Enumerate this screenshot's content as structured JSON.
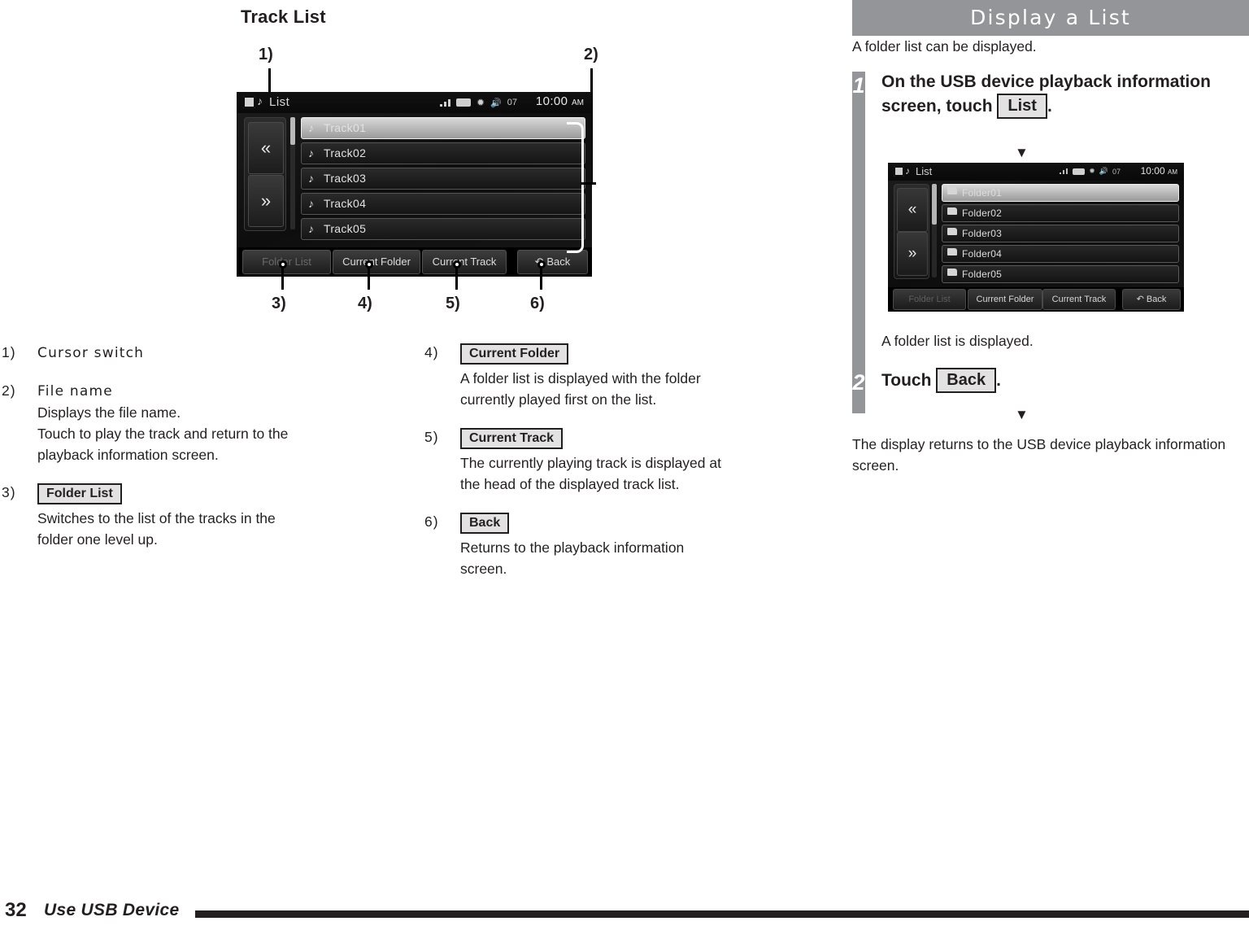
{
  "figure": {
    "title": "Track List",
    "callout_labels": [
      "1)",
      "2)",
      "3)",
      "4)",
      "5)",
      "6)"
    ],
    "device_screen": {
      "title": "List",
      "clock": "10:00",
      "clock_ampm": "AM",
      "volume": "07",
      "status_icons": [
        "signal-icon",
        "battery-icon",
        "bluetooth-icon",
        "volume-icon"
      ],
      "rows": [
        {
          "icon": "music-note-icon",
          "label": "Track01",
          "selected": true
        },
        {
          "icon": "music-note-icon",
          "label": "Track02",
          "selected": false
        },
        {
          "icon": "music-note-icon",
          "label": "Track03",
          "selected": false
        },
        {
          "icon": "music-note-icon",
          "label": "Track04",
          "selected": false
        },
        {
          "icon": "music-note-icon",
          "label": "Track05",
          "selected": false
        }
      ],
      "cursor_up": "«",
      "cursor_down": "»",
      "buttons": {
        "folder_list": "Folder List",
        "current_folder": "Current Folder",
        "current_track": "Current Track",
        "back": "Back"
      }
    }
  },
  "explanations": {
    "left": [
      {
        "num": "1)",
        "term": "Cursor switch",
        "is_key": false,
        "lines": []
      },
      {
        "num": "2)",
        "term": "File name",
        "is_key": false,
        "lines": [
          "Displays the file name.",
          "Touch to play the track and return to the",
          "playback information screen."
        ]
      },
      {
        "num": "3)",
        "term": "Folder List",
        "is_key": true,
        "lines": [
          "Switches to the list of the tracks in the",
          "folder one level up."
        ]
      }
    ],
    "right": [
      {
        "num": "4)",
        "term": "Current Folder",
        "is_key": true,
        "lines": [
          "A folder list is displayed with the folder",
          "currently played first on the list."
        ]
      },
      {
        "num": "5)",
        "term": "Current Track",
        "is_key": true,
        "lines": [
          "The currently playing track is displayed at",
          "the head of the displayed track list."
        ]
      },
      {
        "num": "6)",
        "term": "Back",
        "is_key": true,
        "lines": [
          "Returns to the playback information",
          "screen."
        ]
      }
    ]
  },
  "section": {
    "header": "Display a List",
    "intro": "A folder list can be displayed.",
    "steps": [
      {
        "number": "1",
        "title_before": "On the USB device playback information screen, touch",
        "key": "List",
        "title_after": ".",
        "arrow": "▼",
        "result": "A folder list is displayed."
      },
      {
        "number": "2",
        "title_before": "Touch",
        "key": "Back",
        "title_after": ".",
        "arrow": "▼",
        "result": "The display returns to the USB device playback information screen."
      }
    ],
    "folder_screen": {
      "title": "List",
      "clock": "10:00",
      "clock_ampm": "AM",
      "volume": "07",
      "rows": [
        {
          "icon": "folder-icon",
          "label": "Folder01",
          "selected": true
        },
        {
          "icon": "folder-icon",
          "label": "Folder02",
          "selected": false
        },
        {
          "icon": "folder-icon",
          "label": "Folder03",
          "selected": false
        },
        {
          "icon": "folder-icon",
          "label": "Folder04",
          "selected": false
        },
        {
          "icon": "folder-icon",
          "label": "Folder05",
          "selected": false
        }
      ],
      "cursor_up": "«",
      "cursor_down": "»",
      "buttons": {
        "folder_list": "Folder List",
        "current_folder": "Current Folder",
        "current_track": "Current Track",
        "back": "Back"
      }
    }
  },
  "footer": {
    "page_number": "32",
    "section_name": "Use USB Device"
  },
  "colors": {
    "accent_gray": "#939598",
    "ink": "#231f20",
    "keycap_fill": "#e2e2e2"
  }
}
